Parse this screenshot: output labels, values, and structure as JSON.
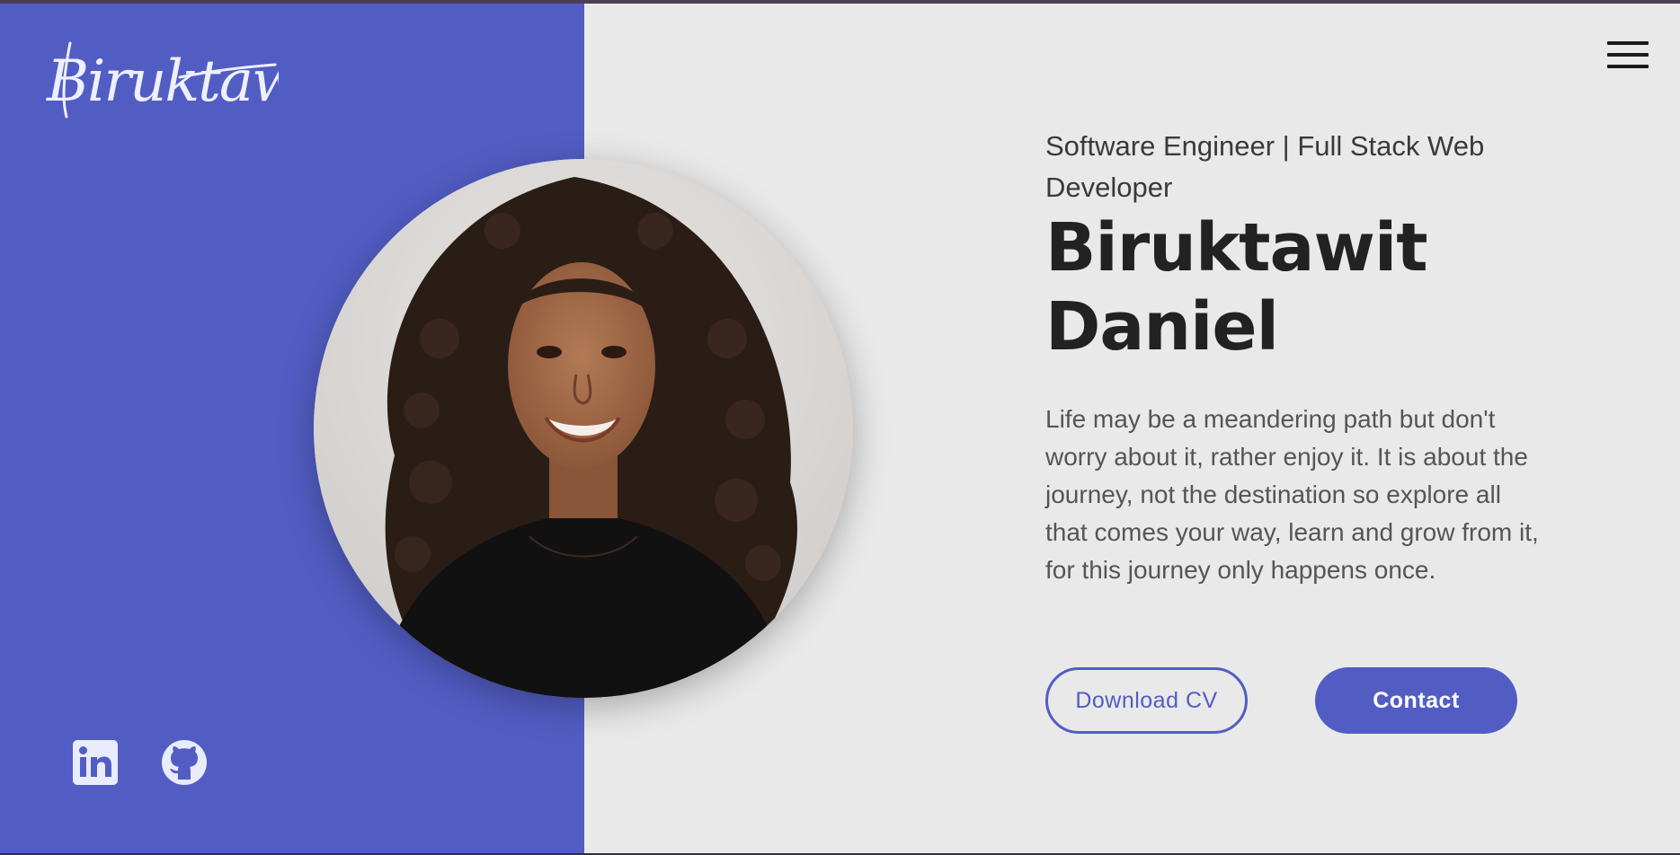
{
  "brand": {
    "signature": "Biruktawit"
  },
  "nav": {
    "menu_icon": "hamburger-menu-icon"
  },
  "hero": {
    "subtitle": "Software Engineer | Full Stack Web Developer",
    "name_first": "Biruktawit",
    "name_last": "Daniel",
    "tagline": "Life may be a meandering path but don't worry about it, rather enjoy it. It is about the journey, not the destination so explore all that comes your way, learn and grow from it, for this journey only happens once.",
    "download_cv_label": "Download CV",
    "contact_label": "Contact"
  },
  "social": {
    "linkedin_icon": "linkedin-icon",
    "github_icon": "github-icon"
  },
  "colors": {
    "accent": "#525dc4",
    "background": "#e9e9e9",
    "text_dark": "#222222",
    "text_muted": "#555555"
  }
}
